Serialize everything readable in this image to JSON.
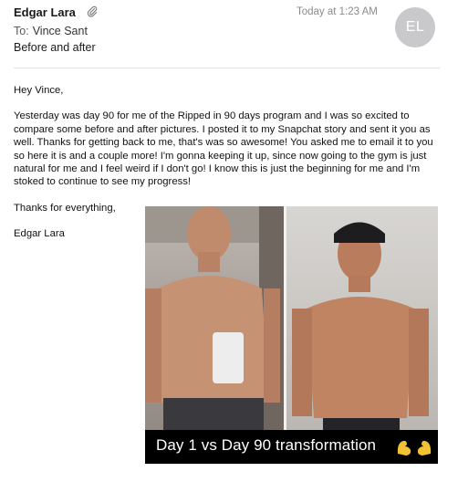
{
  "email": {
    "sender": "Edgar Lara",
    "to_label": "To:",
    "to_name": "Vince Sant",
    "subject": "Before and after",
    "time": "Today at 1:23 AM",
    "avatar_initials": "EL"
  },
  "body": {
    "greeting": "Hey Vince,",
    "paragraph": "Yesterday was day 90 for me of the Ripped in 90 days program and I was so excited to compare some before and after pictures. I posted it to my Snapchat story and sent it you as well. Thanks for getting back to me, that's was so awesome! You asked me to email it to you so here it is and a couple more! I'm gonna keeping it up, since now going to the gym is just natural for me and I feel weird if I don't go! I know this is just the beginning for me and I'm stoked to continue to see my progress!",
    "closing": "Thanks for everything,",
    "signature": "Edgar Lara"
  },
  "attachment": {
    "caption": "Day 1 vs Day 90 transformation"
  },
  "colors": {
    "avatar_bg": "#c9c9cc",
    "time_text": "#8a8a8a",
    "flex_emoji": "#f1c232"
  },
  "icons": {
    "attachment": "paperclip-icon",
    "flex": "flexed-biceps-icon"
  }
}
